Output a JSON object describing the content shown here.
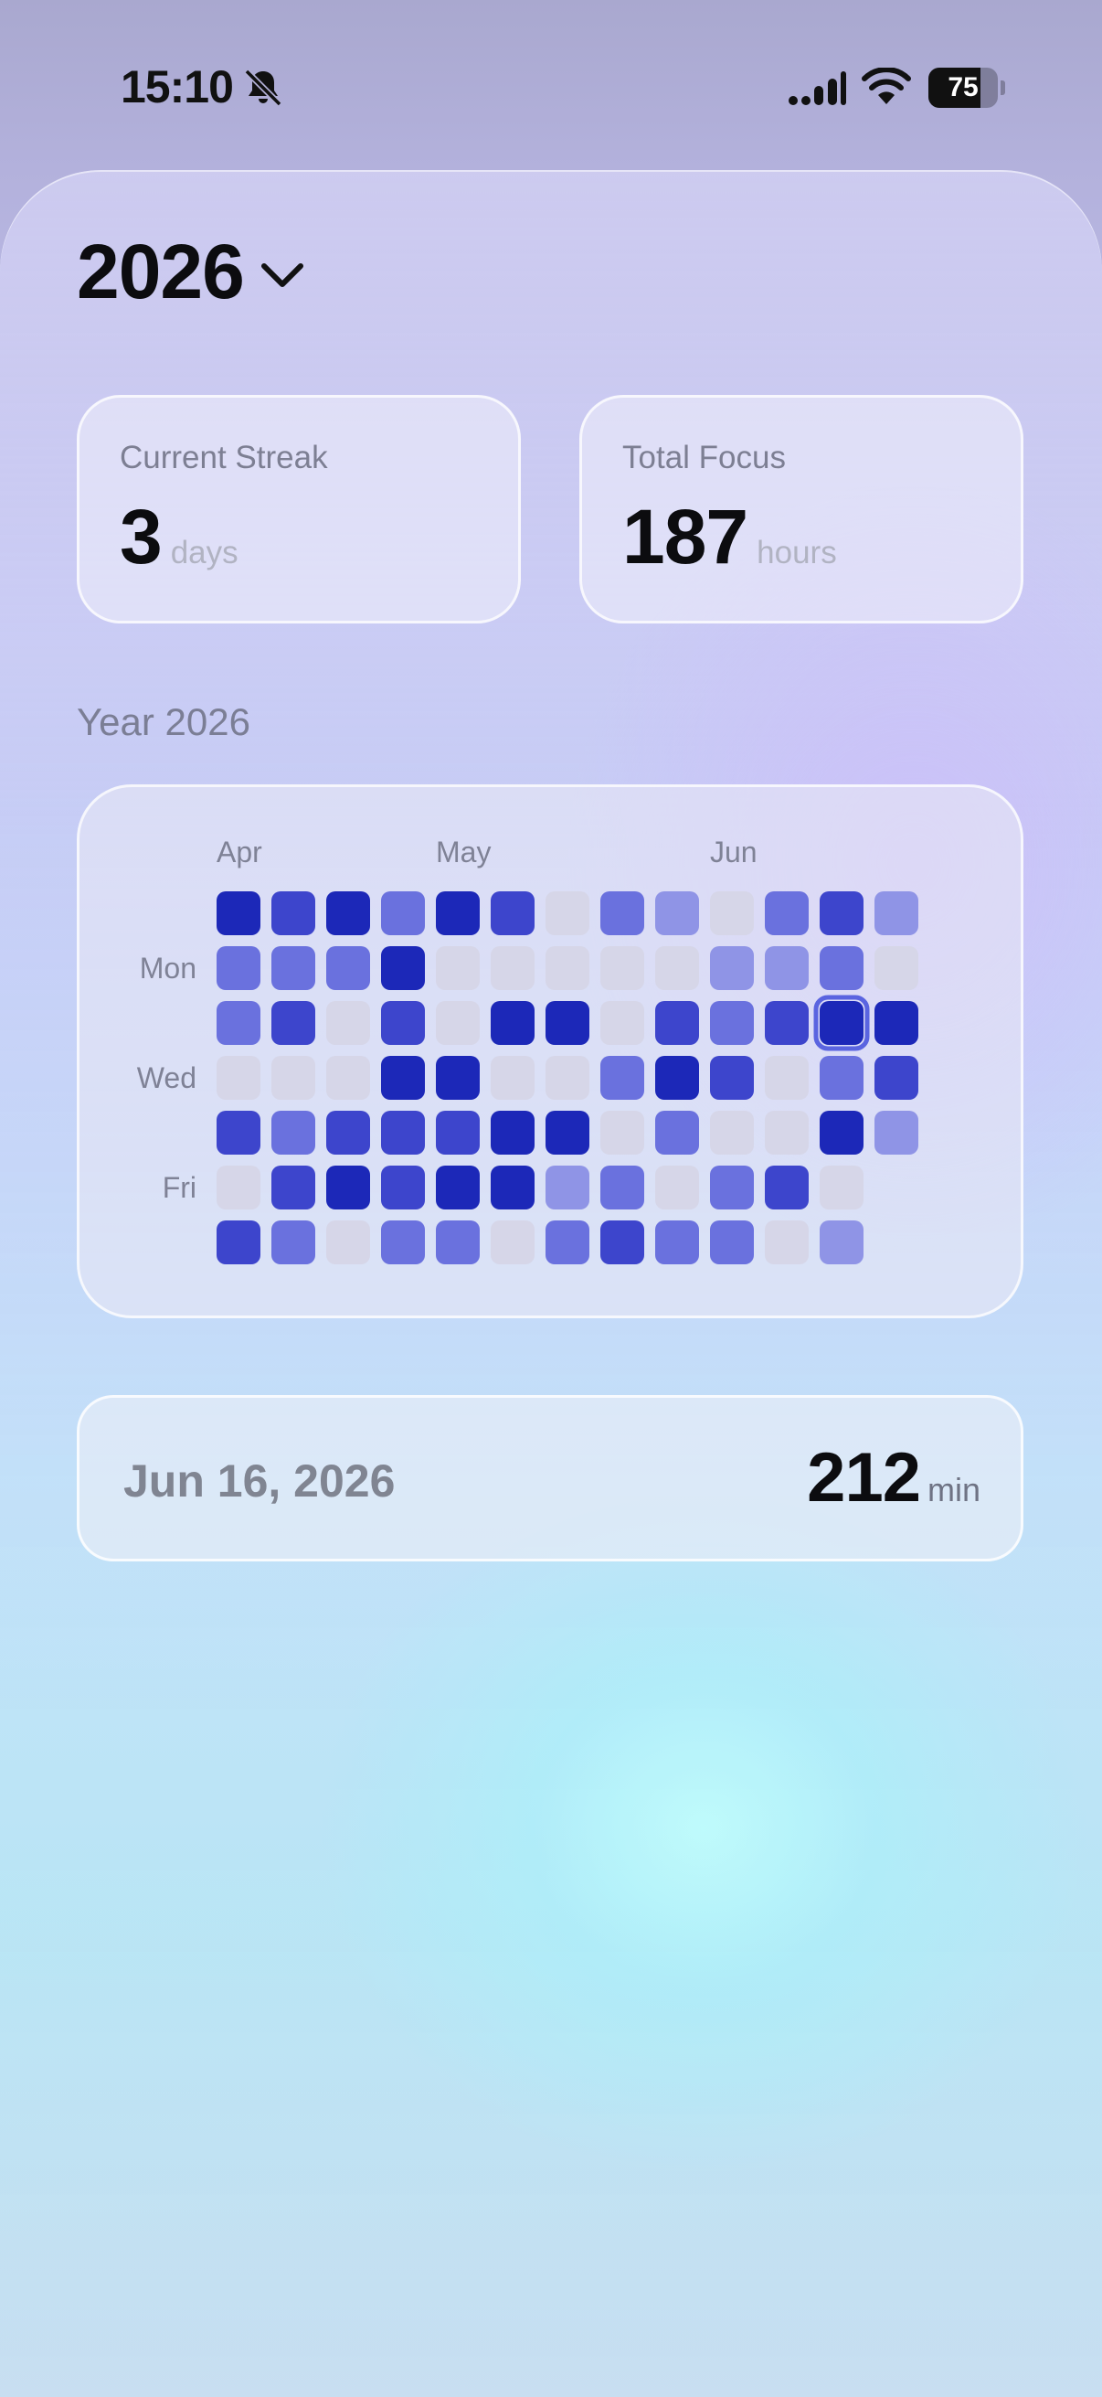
{
  "status_bar": {
    "time": "15:10",
    "battery_level": "75",
    "icons": [
      "bell-slash-icon",
      "signal-icon",
      "wifi-icon",
      "battery-icon"
    ]
  },
  "header": {
    "year": "2026",
    "dropdown_icon": "chevron-down-icon"
  },
  "stats": {
    "current_streak": {
      "label": "Current Streak",
      "value": "3",
      "unit": "days"
    },
    "total_focus": {
      "label": "Total Focus",
      "value": "187",
      "unit": "hours"
    }
  },
  "heatmap": {
    "title": "Year 2026",
    "month_labels": [
      "Apr",
      "May",
      "Jun"
    ],
    "month_label_columns": [
      0,
      4,
      9
    ],
    "day_labels": [
      "Mon",
      "Wed",
      "Fri"
    ],
    "day_label_rows": [
      1,
      3,
      5
    ],
    "levels": [
      [
        4,
        3,
        4,
        2,
        4,
        3,
        0,
        2,
        1,
        0,
        2,
        3,
        1
      ],
      [
        2,
        2,
        2,
        4,
        0,
        0,
        0,
        0,
        0,
        1,
        1,
        2,
        0
      ],
      [
        2,
        3,
        0,
        3,
        0,
        4,
        4,
        0,
        3,
        2,
        3,
        4,
        4
      ],
      [
        0,
        0,
        0,
        4,
        4,
        0,
        0,
        2,
        4,
        3,
        0,
        2,
        3
      ],
      [
        3,
        2,
        3,
        3,
        3,
        4,
        4,
        0,
        2,
        0,
        0,
        4,
        1
      ],
      [
        0,
        3,
        4,
        3,
        4,
        4,
        1,
        2,
        0,
        2,
        3,
        0,
        null
      ],
      [
        3,
        2,
        0,
        2,
        2,
        0,
        2,
        3,
        2,
        2,
        0,
        1,
        null
      ]
    ],
    "selected": {
      "row": 2,
      "col": 11
    },
    "level_colors": [
      "#d6d6e8",
      "#8f94e6",
      "#6a71de",
      "#3d45cc",
      "#1c28b8"
    ],
    "selected_outline_color": "#5a64e0"
  },
  "selected_day": {
    "date": "Jun 16, 2026",
    "value": "212",
    "unit": "min"
  }
}
